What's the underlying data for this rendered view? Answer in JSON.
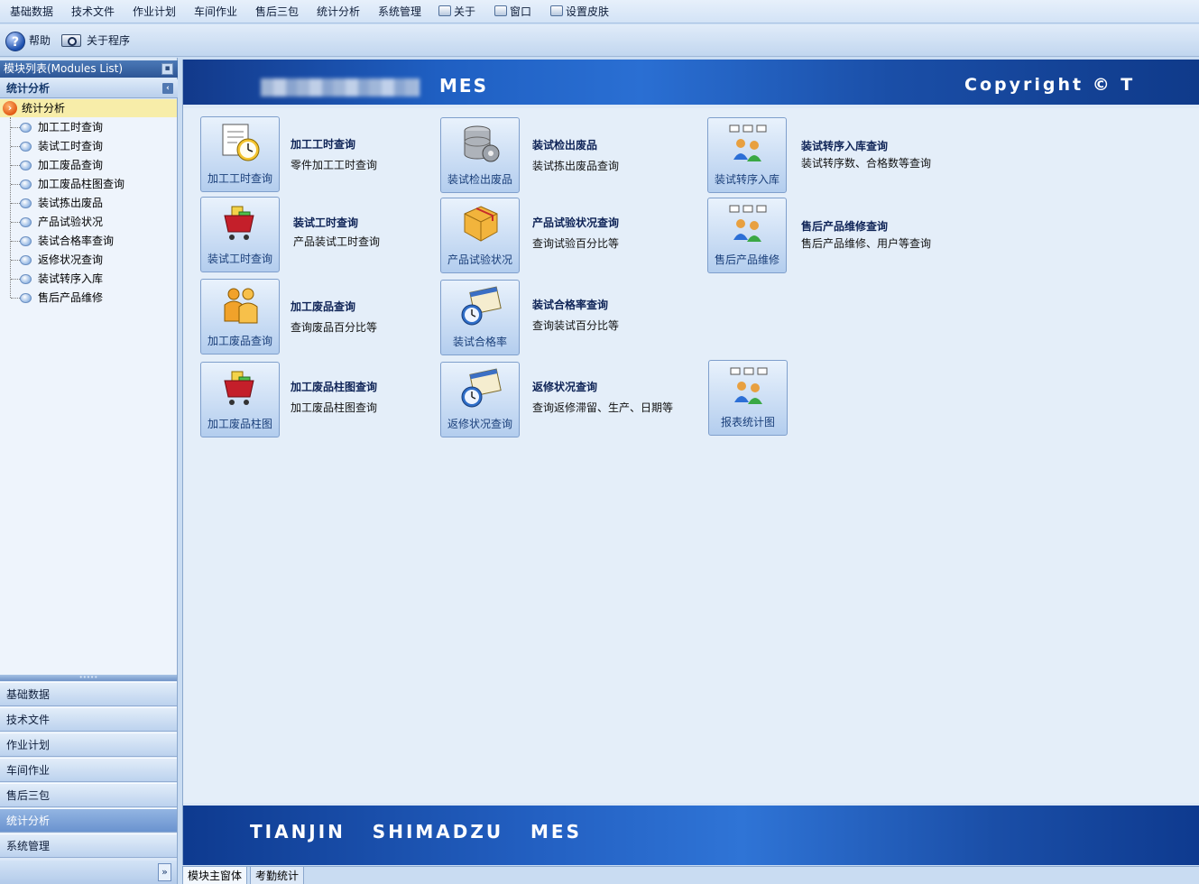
{
  "menu": [
    "基础数据",
    "技术文件",
    "作业计划",
    "车间作业",
    "售后三包",
    "统计分析",
    "系统管理",
    "关于",
    "窗口",
    "设置皮肤"
  ],
  "toolbar": {
    "help": "帮助",
    "about": "关于程序"
  },
  "left_panel": {
    "title": "模块列表(Modules List)",
    "group": "统计分析",
    "tree_root": "统计分析",
    "tree_items": [
      "加工工时查询",
      "装试工时查询",
      "加工废品查询",
      "加工废品柱图查询",
      "装试拣出废品",
      "产品试验状况",
      "装试合格率查询",
      "返修状况查询",
      "装试转序入库",
      "售后产品维修"
    ],
    "nav": [
      "基础数据",
      "技术文件",
      "作业计划",
      "车间作业",
      "售后三包",
      "统计分析",
      "系统管理"
    ],
    "active_nav": "统计分析"
  },
  "banner": {
    "mes": "MES",
    "copyright": "Copyright © T",
    "bottom": "TIANJIN   SHIMADZU   MES"
  },
  "modules": [
    {
      "button": "加工工时查询",
      "title": "加工工时查询",
      "desc": "零件加工工时查询",
      "icon": "clock-document-icon"
    },
    {
      "button": "装试检出废品",
      "title": "装试检出废品",
      "desc": "装试拣出废品查询",
      "icon": "database-gear-icon"
    },
    {
      "button": "装试转序入库",
      "title": "装试转序入库查询",
      "desc": "装试转序数、合格数等查询",
      "icon": "users-network-icon"
    },
    {
      "button": "装试工时查询",
      "title": "装试工时查询",
      "desc": "产品装试工时查询",
      "icon": "shopping-cart-icon"
    },
    {
      "button": "产品试验状况",
      "title": "产品试验状况查询",
      "desc": "查询试验百分比等",
      "icon": "package-box-icon"
    },
    {
      "button": "售后产品维修",
      "title": "售后产品维修查询",
      "desc": "售后产品维修、用户等查询",
      "icon": "users-network-icon"
    },
    {
      "button": "加工废品查询",
      "title": "加工废品查询",
      "desc": "查询废品百分比等",
      "icon": "people-group-icon"
    },
    {
      "button": "装试合格率",
      "title": "装试合格率查询",
      "desc": "查询装试百分比等",
      "icon": "calendar-clock-icon"
    },
    {
      "button": "加工废品柱图",
      "title": "加工废品柱图查询",
      "desc": "加工废品柱图查询",
      "icon": "shopping-cart-icon"
    },
    {
      "button": "返修状况查询",
      "title": "返修状况查询",
      "desc": "查询返修滞留、生产、日期等",
      "icon": "calendar-clock-icon"
    },
    {
      "button": "报表统计图",
      "title": "",
      "desc": "",
      "icon": "users-network-icon"
    }
  ],
  "tabs": [
    "模块主窗体",
    "考勤统计"
  ]
}
